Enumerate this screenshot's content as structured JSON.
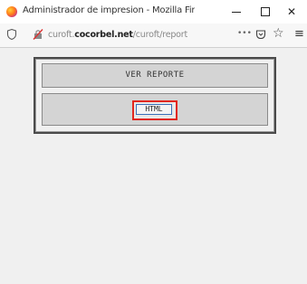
{
  "window": {
    "title": "Administrador de impresion - Mozilla Firef...",
    "minimize_label": "—",
    "maximize_label": "",
    "close_label": "✕"
  },
  "urlbar": {
    "url_prefix": "curoft.",
    "url_domain": "cocorbel.net",
    "url_path": "/curoft/report",
    "more_label": "•••",
    "star_label": "☆",
    "menu_label": "≡"
  },
  "panel": {
    "report_button_label": "VER REPORTE",
    "html_button_label": "HTML"
  },
  "colors": {
    "highlight": "#e1271e",
    "focus": "#3a6fb8"
  }
}
